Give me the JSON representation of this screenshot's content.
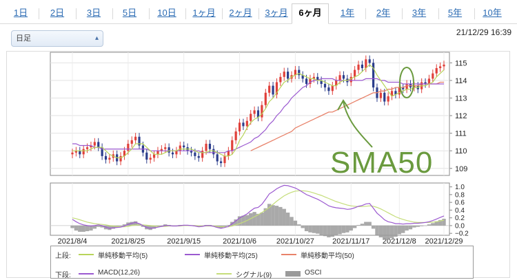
{
  "tabs": [
    {
      "label": "1日"
    },
    {
      "label": "2日"
    },
    {
      "label": "3日"
    },
    {
      "label": "5日"
    },
    {
      "label": "10日"
    },
    {
      "label": "1ヶ月"
    },
    {
      "label": "2ヶ月"
    },
    {
      "label": "3ヶ月"
    },
    {
      "label": "6ヶ月",
      "active": true
    },
    {
      "label": "1年"
    },
    {
      "label": "2年"
    },
    {
      "label": "3年"
    },
    {
      "label": "5年"
    },
    {
      "label": "10年"
    }
  ],
  "period_select": {
    "value": "日足"
  },
  "timestamp": "21/12/29 16:39",
  "annotation": {
    "text": "SMA50",
    "color": "#6a9a3e"
  },
  "colors": {
    "up": "#e0403a",
    "down": "#2c3e8c",
    "sma5": "#b8d45a",
    "sma25": "#9b59d0",
    "sma50": "#e8826a",
    "macd": "#9b59d0",
    "signal": "#c5dd7a",
    "osci": "#9a9a9a",
    "annotation": "#6a9a3e"
  },
  "legend": {
    "upper_label": "上段:",
    "lower_label": "下段:",
    "upper_items": [
      {
        "label": "単純移動平均(5)",
        "color": "#b8d45a"
      },
      {
        "label": "単純移動平均(25)",
        "color": "#9b59d0"
      },
      {
        "label": "単純移動平均(50)",
        "color": "#e8826a"
      }
    ],
    "lower_items": [
      {
        "label": "MACD(12,26)",
        "color": "#9b59d0",
        "kind": "line"
      },
      {
        "label": "シグナル(9)",
        "color": "#c5dd7a",
        "kind": "line"
      },
      {
        "label": "OSCI",
        "color": "#9a9a9a",
        "kind": "bar"
      }
    ]
  },
  "chart_data": [
    {
      "type": "candlestick",
      "title": "",
      "ylim": [
        108.6,
        115.6
      ],
      "yticks": [
        109,
        110,
        111,
        112,
        113,
        114,
        115
      ],
      "x_tick_labels": [
        "2021/8/4",
        "2021/8/25",
        "2021/9/15",
        "2021/10/6",
        "2021/10/27",
        "2021/11/17",
        "2021/12/8",
        "2021/12/29"
      ],
      "close_values": [
        109.9,
        110.0,
        109.8,
        110.1,
        110.2,
        110.3,
        110.5,
        110.2,
        109.7,
        109.5,
        109.6,
        109.8,
        109.4,
        109.7,
        110.0,
        110.4,
        110.6,
        110.8,
        110.3,
        109.9,
        109.5,
        109.6,
        109.8,
        110.0,
        110.1,
        110.2,
        109.9,
        109.8,
        110.0,
        110.3,
        110.2,
        110.0,
        109.9,
        109.7,
        109.6,
        110.0,
        110.4,
        110.1,
        109.8,
        109.4,
        109.3,
        109.7,
        110.0,
        110.6,
        111.1,
        111.6,
        111.4,
        111.7,
        112.1,
        112.3,
        111.9,
        112.6,
        113.3,
        113.7,
        113.2,
        113.9,
        114.2,
        114.5,
        114.1,
        114.3,
        114.6,
        114.3,
        114.1,
        113.8,
        114.1,
        114.2,
        114.0,
        113.8,
        113.6,
        113.4,
        113.7,
        114.0,
        114.3,
        114.1,
        113.9,
        114.2,
        114.6,
        114.9,
        114.7,
        115.2,
        115.0,
        113.6,
        113.0,
        113.3,
        112.8,
        113.1,
        113.4,
        113.2,
        113.6,
        113.5,
        113.8,
        113.6,
        113.7,
        113.5,
        113.9,
        113.8,
        114.1,
        114.4,
        114.7,
        114.8,
        114.9
      ],
      "sma5": [
        110.0,
        110.0,
        110.0,
        110.0,
        110.0,
        110.1,
        110.2,
        110.2,
        110.2,
        110.0,
        109.8,
        109.7,
        109.6,
        109.6,
        109.7,
        109.9,
        110.1,
        110.4,
        110.4,
        110.4,
        110.2,
        110.0,
        109.8,
        109.8,
        109.8,
        109.9,
        110.0,
        110.0,
        110.0,
        110.1,
        110.1,
        110.1,
        110.1,
        110.0,
        109.9,
        109.9,
        109.9,
        110.0,
        110.0,
        109.9,
        109.8,
        109.7,
        109.7,
        109.8,
        110.1,
        110.6,
        110.9,
        111.3,
        111.6,
        111.8,
        111.9,
        112.1,
        112.4,
        112.8,
        113.0,
        113.3,
        113.6,
        113.9,
        114.0,
        114.2,
        114.3,
        114.4,
        114.3,
        114.2,
        114.1,
        114.1,
        114.0,
        114.0,
        113.9,
        113.8,
        113.7,
        113.7,
        113.9,
        114.0,
        114.0,
        114.1,
        114.2,
        114.3,
        114.5,
        114.7,
        114.9,
        114.7,
        114.3,
        114.0,
        113.7,
        113.4,
        113.1,
        113.2,
        113.3,
        113.4,
        113.5,
        113.5,
        113.6,
        113.6,
        113.7,
        113.7,
        113.8,
        113.9,
        114.2,
        114.4,
        114.6
      ],
      "sma25": [
        110.4,
        110.4,
        110.3,
        110.3,
        110.3,
        110.3,
        110.2,
        110.2,
        110.1,
        110.1,
        110.1,
        110.1,
        110.1,
        110.1,
        110.1,
        110.1,
        110.1,
        110.1,
        110.1,
        110.1,
        110.1,
        110.0,
        110.0,
        110.0,
        110.0,
        110.0,
        110.0,
        110.0,
        110.0,
        110.0,
        110.0,
        110.0,
        110.0,
        110.0,
        110.0,
        109.9,
        109.9,
        109.9,
        109.9,
        109.9,
        109.9,
        109.9,
        110.0,
        110.0,
        110.1,
        110.2,
        110.3,
        110.4,
        110.5,
        110.7,
        110.8,
        111.0,
        111.2,
        111.5,
        111.7,
        112.0,
        112.2,
        112.5,
        112.7,
        113.0,
        113.2,
        113.4,
        113.6,
        113.7,
        113.9,
        114.0,
        114.0,
        114.1,
        114.1,
        114.1,
        114.1,
        114.0,
        114.0,
        114.0,
        114.0,
        114.0,
        114.0,
        114.0,
        114.0,
        114.1,
        114.1,
        114.1,
        114.1,
        114.0,
        114.0,
        113.9,
        113.9,
        113.9,
        113.9,
        113.8,
        113.8,
        113.8,
        113.8,
        113.8,
        113.8,
        113.8,
        113.8,
        113.8,
        113.8,
        113.8,
        113.8
      ],
      "sma50": [
        null,
        null,
        null,
        null,
        null,
        null,
        null,
        null,
        null,
        null,
        null,
        null,
        null,
        null,
        null,
        null,
        null,
        null,
        null,
        null,
        null,
        null,
        null,
        null,
        null,
        null,
        null,
        null,
        null,
        null,
        null,
        null,
        null,
        null,
        null,
        null,
        null,
        null,
        null,
        null,
        null,
        null,
        null,
        null,
        null,
        null,
        null,
        null,
        110.0,
        110.1,
        110.2,
        110.3,
        110.4,
        110.5,
        110.6,
        110.7,
        110.8,
        110.9,
        111.0,
        111.1,
        111.3,
        111.4,
        111.5,
        111.6,
        111.7,
        111.8,
        111.9,
        112.0,
        112.1,
        112.2,
        112.2,
        112.3,
        112.4,
        112.5,
        112.6,
        112.7,
        112.8,
        112.9,
        113.0,
        113.1,
        113.2,
        113.3,
        113.3,
        113.4,
        113.4,
        113.5,
        113.5,
        113.6,
        113.6,
        113.6,
        113.7,
        113.7,
        113.7,
        113.7,
        113.8,
        113.8,
        113.8,
        113.8,
        113.8,
        113.9,
        113.9
      ]
    },
    {
      "type": "macd",
      "ylim": [
        -0.25,
        1.1
      ],
      "yticks": [
        1.0,
        0.8,
        0.6,
        0.4,
        0.2,
        0.0,
        -0.2
      ],
      "ytick_labels": [
        "1.0",
        "0.8",
        "0.6",
        "0.4",
        "0.2",
        "0.0",
        "−0.2"
      ],
      "macd": [
        0.16,
        0.1,
        0.05,
        0.02,
        0.0,
        -0.01,
        0.0,
        0.02,
        0.0,
        -0.04,
        -0.07,
        -0.06,
        -0.05,
        -0.04,
        -0.01,
        0.03,
        0.06,
        0.08,
        0.05,
        0.0,
        -0.05,
        -0.07,
        -0.06,
        -0.04,
        -0.02,
        0.0,
        0.0,
        -0.01,
        -0.01,
        0.0,
        0.01,
        0.01,
        0.0,
        -0.01,
        -0.03,
        -0.02,
        0.0,
        0.0,
        -0.02,
        -0.05,
        -0.07,
        -0.05,
        -0.02,
        0.05,
        0.12,
        0.2,
        0.25,
        0.3,
        0.38,
        0.45,
        0.47,
        0.55,
        0.68,
        0.82,
        0.88,
        0.95,
        1.0,
        1.04,
        1.03,
        1.0,
        0.97,
        0.92,
        0.86,
        0.8,
        0.76,
        0.72,
        0.68,
        0.63,
        0.57,
        0.51,
        0.48,
        0.46,
        0.45,
        0.44,
        0.42,
        0.43,
        0.46,
        0.5,
        0.52,
        0.56,
        0.57,
        0.45,
        0.32,
        0.24,
        0.15,
        0.1,
        0.08,
        0.05,
        0.05,
        0.04,
        0.05,
        0.05,
        0.06,
        0.06,
        0.07,
        0.08,
        0.1,
        0.13,
        0.17,
        0.21,
        0.25
      ],
      "signal": [
        0.2,
        0.18,
        0.15,
        0.12,
        0.09,
        0.07,
        0.05,
        0.04,
        0.03,
        0.02,
        0.0,
        -0.01,
        -0.02,
        -0.03,
        -0.03,
        -0.02,
        0.0,
        0.01,
        0.02,
        0.02,
        0.01,
        0.0,
        -0.01,
        -0.02,
        -0.02,
        -0.02,
        -0.01,
        -0.01,
        -0.01,
        -0.01,
        0.0,
        0.0,
        0.0,
        0.0,
        -0.01,
        -0.01,
        -0.01,
        -0.01,
        -0.01,
        -0.02,
        -0.03,
        -0.03,
        -0.03,
        -0.01,
        0.02,
        0.05,
        0.09,
        0.13,
        0.18,
        0.23,
        0.28,
        0.34,
        0.4,
        0.47,
        0.55,
        0.63,
        0.7,
        0.77,
        0.82,
        0.86,
        0.89,
        0.9,
        0.9,
        0.89,
        0.87,
        0.84,
        0.81,
        0.78,
        0.74,
        0.7,
        0.66,
        0.62,
        0.59,
        0.56,
        0.53,
        0.51,
        0.5,
        0.49,
        0.49,
        0.5,
        0.51,
        0.5,
        0.47,
        0.43,
        0.38,
        0.33,
        0.28,
        0.23,
        0.19,
        0.16,
        0.13,
        0.11,
        0.09,
        0.08,
        0.08,
        0.08,
        0.08,
        0.09,
        0.1,
        0.12,
        0.14
      ]
    }
  ]
}
